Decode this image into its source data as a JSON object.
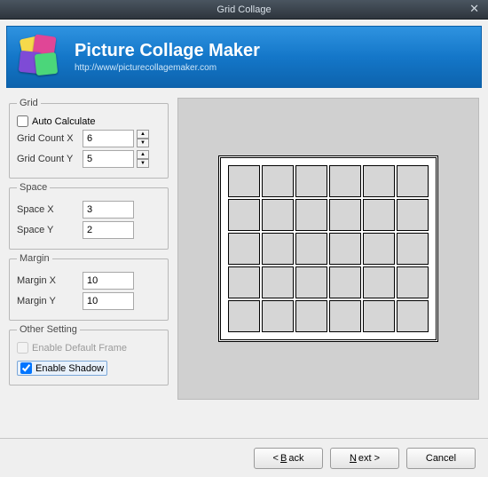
{
  "window": {
    "title": "Grid Collage"
  },
  "banner": {
    "title": "Picture Collage Maker",
    "url": "http://www/picturecollagemaker.com"
  },
  "grid": {
    "legend": "Grid",
    "autoCalculate": {
      "label": "Auto Calculate",
      "checked": false
    },
    "countX": {
      "label": "Grid Count X",
      "value": "6"
    },
    "countY": {
      "label": "Grid Count Y",
      "value": "5"
    }
  },
  "space": {
    "legend": "Space",
    "x": {
      "label": "Space X",
      "value": "3"
    },
    "y": {
      "label": "Space Y",
      "value": "2"
    }
  },
  "margin": {
    "legend": "Margin",
    "x": {
      "label": "Margin X",
      "value": "10"
    },
    "y": {
      "label": "Margin Y",
      "value": "10"
    }
  },
  "other": {
    "legend": "Other Setting",
    "enableDefaultFrame": {
      "label": "Enable Default Frame",
      "checked": false,
      "disabled": true
    },
    "enableShadow": {
      "label": "Enable Shadow",
      "checked": true
    }
  },
  "buttons": {
    "back": "< Back",
    "next": "Next >",
    "cancel": "Cancel"
  }
}
